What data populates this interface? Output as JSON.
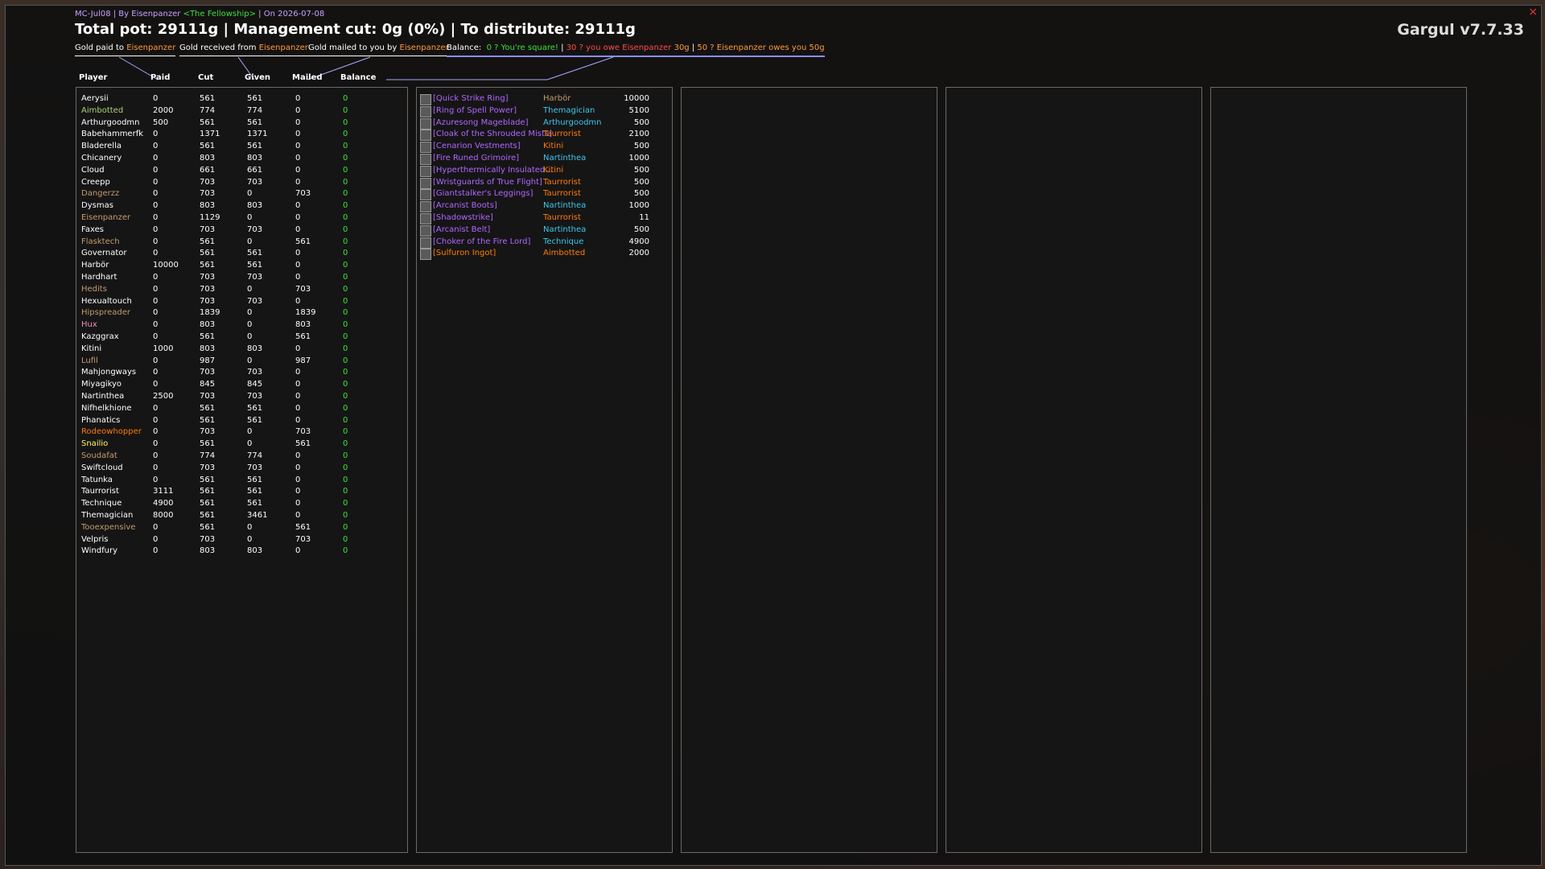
{
  "header": {
    "subtitle_prefix": "MC-Jul08 | By Eisenpanzer",
    "guild": "<The Fellowship>",
    "subtitle_suffix": "| On 2026-07-08",
    "title": "Total pot: 29111g | Management cut: 0g (0%) | To distribute: 29111g",
    "version": "Gargul v7.7.33",
    "close": "×"
  },
  "legend": {
    "gold_paid_label": "Gold paid to",
    "gold_paid_who": "Eisenpanzer",
    "gold_received_label": "Gold received from",
    "gold_received_who": "Eisenpanzer",
    "gold_mailed_label": "Gold mailed to you by",
    "gold_mailed_who": "Eisenpanzer",
    "balance_label": "Balance:",
    "balance_square": "0 ? You're square!",
    "balance_owe_prefix": "30 ? you owe Eisenpanzer",
    "balance_owe_amount": "30g",
    "balance_owes_you": "50 ? Eisenpanzer owes you 50g"
  },
  "columns": {
    "player": "Player",
    "paid": "Paid",
    "cut": "Cut",
    "given": "Given",
    "mailed": "Mailed",
    "balance": "Balance"
  },
  "colors": {
    "warrior": "#c69b6d",
    "druid": "#ff7c0a",
    "hunter": "#aad372",
    "rogue": "#fff468",
    "priest": "#ffffff",
    "shaman": "#0070dd",
    "mage": "#3fc7eb",
    "warlock": "#8788ee",
    "paladin": "#f48cba",
    "epic": "#b266ff",
    "legendary": "#ff8000",
    "green": "#3ce03c"
  },
  "players": [
    {
      "name": "Aerysii",
      "cls": "priest",
      "paid": "0",
      "cut": "561",
      "given": "561",
      "mailed": "0",
      "balance": "0"
    },
    {
      "name": "Aimbotted",
      "cls": "hunter",
      "paid": "2000",
      "cut": "774",
      "given": "774",
      "mailed": "0",
      "balance": "0"
    },
    {
      "name": "Arthurgoodmn",
      "cls": "priest",
      "paid": "500",
      "cut": "561",
      "given": "561",
      "mailed": "0",
      "balance": "0"
    },
    {
      "name": "Babehammerfk",
      "cls": "priest",
      "paid": "0",
      "cut": "1371",
      "given": "1371",
      "mailed": "0",
      "balance": "0"
    },
    {
      "name": "Bladerella",
      "cls": "priest",
      "paid": "0",
      "cut": "561",
      "given": "561",
      "mailed": "0",
      "balance": "0"
    },
    {
      "name": "Chicanery",
      "cls": "priest",
      "paid": "0",
      "cut": "803",
      "given": "803",
      "mailed": "0",
      "balance": "0"
    },
    {
      "name": "Cloud",
      "cls": "priest",
      "paid": "0",
      "cut": "661",
      "given": "661",
      "mailed": "0",
      "balance": "0"
    },
    {
      "name": "Creepp",
      "cls": "priest",
      "paid": "0",
      "cut": "703",
      "given": "703",
      "mailed": "0",
      "balance": "0"
    },
    {
      "name": "Dangerzz",
      "cls": "warrior",
      "paid": "0",
      "cut": "703",
      "given": "0",
      "mailed": "703",
      "balance": "0"
    },
    {
      "name": "Dysmas",
      "cls": "priest",
      "paid": "0",
      "cut": "803",
      "given": "803",
      "mailed": "0",
      "balance": "0"
    },
    {
      "name": "Eisenpanzer",
      "cls": "warrior",
      "paid": "0",
      "cut": "1129",
      "given": "0",
      "mailed": "0",
      "balance": "0"
    },
    {
      "name": "Faxes",
      "cls": "priest",
      "paid": "0",
      "cut": "703",
      "given": "703",
      "mailed": "0",
      "balance": "0"
    },
    {
      "name": "Flasktech",
      "cls": "warrior",
      "paid": "0",
      "cut": "561",
      "given": "0",
      "mailed": "561",
      "balance": "0"
    },
    {
      "name": "Governator",
      "cls": "priest",
      "paid": "0",
      "cut": "561",
      "given": "561",
      "mailed": "0",
      "balance": "0"
    },
    {
      "name": "Harbör",
      "cls": "priest",
      "paid": "10000",
      "cut": "561",
      "given": "561",
      "mailed": "0",
      "balance": "0"
    },
    {
      "name": "Hardhart",
      "cls": "priest",
      "paid": "0",
      "cut": "703",
      "given": "703",
      "mailed": "0",
      "balance": "0"
    },
    {
      "name": "Hedits",
      "cls": "warrior",
      "paid": "0",
      "cut": "703",
      "given": "0",
      "mailed": "703",
      "balance": "0"
    },
    {
      "name": "Hexualtouch",
      "cls": "priest",
      "paid": "0",
      "cut": "703",
      "given": "703",
      "mailed": "0",
      "balance": "0"
    },
    {
      "name": "Hipspreader",
      "cls": "warrior",
      "paid": "0",
      "cut": "1839",
      "given": "0",
      "mailed": "1839",
      "balance": "0"
    },
    {
      "name": "Hux",
      "cls": "paladin",
      "paid": "0",
      "cut": "803",
      "given": "0",
      "mailed": "803",
      "balance": "0"
    },
    {
      "name": "Kazggrax",
      "cls": "priest",
      "paid": "0",
      "cut": "561",
      "given": "0",
      "mailed": "561",
      "balance": "0"
    },
    {
      "name": "Kitini",
      "cls": "priest",
      "paid": "1000",
      "cut": "803",
      "given": "803",
      "mailed": "0",
      "balance": "0"
    },
    {
      "name": "Lufil",
      "cls": "warrior",
      "paid": "0",
      "cut": "987",
      "given": "0",
      "mailed": "987",
      "balance": "0"
    },
    {
      "name": "Mahjongways",
      "cls": "priest",
      "paid": "0",
      "cut": "703",
      "given": "703",
      "mailed": "0",
      "balance": "0"
    },
    {
      "name": "Miyagikyo",
      "cls": "priest",
      "paid": "0",
      "cut": "845",
      "given": "845",
      "mailed": "0",
      "balance": "0"
    },
    {
      "name": "Nartinthea",
      "cls": "priest",
      "paid": "2500",
      "cut": "703",
      "given": "703",
      "mailed": "0",
      "balance": "0"
    },
    {
      "name": "Nifhelkhione",
      "cls": "priest",
      "paid": "0",
      "cut": "561",
      "given": "561",
      "mailed": "0",
      "balance": "0"
    },
    {
      "name": "Phanatics",
      "cls": "priest",
      "paid": "0",
      "cut": "561",
      "given": "561",
      "mailed": "0",
      "balance": "0"
    },
    {
      "name": "Rodeowhopper",
      "cls": "druid",
      "paid": "0",
      "cut": "703",
      "given": "0",
      "mailed": "703",
      "balance": "0"
    },
    {
      "name": "Snailio",
      "cls": "rogue",
      "paid": "0",
      "cut": "561",
      "given": "0",
      "mailed": "561",
      "balance": "0"
    },
    {
      "name": "Soudafat",
      "cls": "warrior",
      "paid": "0",
      "cut": "774",
      "given": "774",
      "mailed": "0",
      "balance": "0"
    },
    {
      "name": "Swiftcloud",
      "cls": "priest",
      "paid": "0",
      "cut": "703",
      "given": "703",
      "mailed": "0",
      "balance": "0"
    },
    {
      "name": "Tatunka",
      "cls": "priest",
      "paid": "0",
      "cut": "561",
      "given": "561",
      "mailed": "0",
      "balance": "0"
    },
    {
      "name": "Taurrorist",
      "cls": "priest",
      "paid": "3111",
      "cut": "561",
      "given": "561",
      "mailed": "0",
      "balance": "0"
    },
    {
      "name": "Technique",
      "cls": "priest",
      "paid": "4900",
      "cut": "561",
      "given": "561",
      "mailed": "0",
      "balance": "0"
    },
    {
      "name": "Themagician",
      "cls": "priest",
      "paid": "8000",
      "cut": "561",
      "given": "3461",
      "mailed": "0",
      "balance": "0"
    },
    {
      "name": "Tooexpensive",
      "cls": "warrior",
      "paid": "0",
      "cut": "561",
      "given": "0",
      "mailed": "561",
      "balance": "0"
    },
    {
      "name": "Velpris",
      "cls": "priest",
      "paid": "0",
      "cut": "703",
      "given": "0",
      "mailed": "703",
      "balance": "0"
    },
    {
      "name": "Windfury",
      "cls": "priest",
      "paid": "0",
      "cut": "803",
      "given": "803",
      "mailed": "0",
      "balance": "0"
    }
  ],
  "items": [
    {
      "name": "[Quick Strike Ring]",
      "quality": "epic",
      "winner": "Harbör",
      "cls": "warrior",
      "price": "10000"
    },
    {
      "name": "[Ring of Spell Power]",
      "quality": "epic",
      "winner": "Themagician",
      "cls": "mage",
      "price": "5100"
    },
    {
      "name": "[Azuresong Mageblade]",
      "quality": "epic",
      "winner": "Arthurgoodmn",
      "cls": "mage",
      "price": "500"
    },
    {
      "name": "[Cloak of the Shrouded Mists]",
      "quality": "epic",
      "winner": "Taurrorist",
      "cls": "druid",
      "price": "2100"
    },
    {
      "name": "[Cenarion Vestments]",
      "quality": "epic",
      "winner": "Kitini",
      "cls": "druid",
      "price": "500"
    },
    {
      "name": "[Fire Runed Grimoire]",
      "quality": "epic",
      "winner": "Nartinthea",
      "cls": "mage",
      "price": "1000"
    },
    {
      "name": "[Hyperthermically Insulated...",
      "quality": "epic",
      "winner": "Kitini",
      "cls": "druid",
      "price": "500"
    },
    {
      "name": "[Wristguards of True Flight]",
      "quality": "epic",
      "winner": "Taurrorist",
      "cls": "druid",
      "price": "500"
    },
    {
      "name": "[Giantstalker's Leggings]",
      "quality": "epic",
      "winner": "Taurrorist",
      "cls": "druid",
      "price": "500"
    },
    {
      "name": "[Arcanist Boots]",
      "quality": "epic",
      "winner": "Nartinthea",
      "cls": "mage",
      "price": "1000"
    },
    {
      "name": "[Shadowstrike]",
      "quality": "epic",
      "winner": "Taurrorist",
      "cls": "druid",
      "price": "11"
    },
    {
      "name": "[Arcanist Belt]",
      "quality": "epic",
      "winner": "Nartinthea",
      "cls": "mage",
      "price": "500"
    },
    {
      "name": "[Choker of the Fire Lord]",
      "quality": "epic",
      "winner": "Technique",
      "cls": "mage",
      "price": "4900"
    },
    {
      "name": "[Sulfuron Ingot]",
      "quality": "legendary",
      "winner": "Aimbotted",
      "cls": "druid",
      "price": "2000"
    }
  ]
}
